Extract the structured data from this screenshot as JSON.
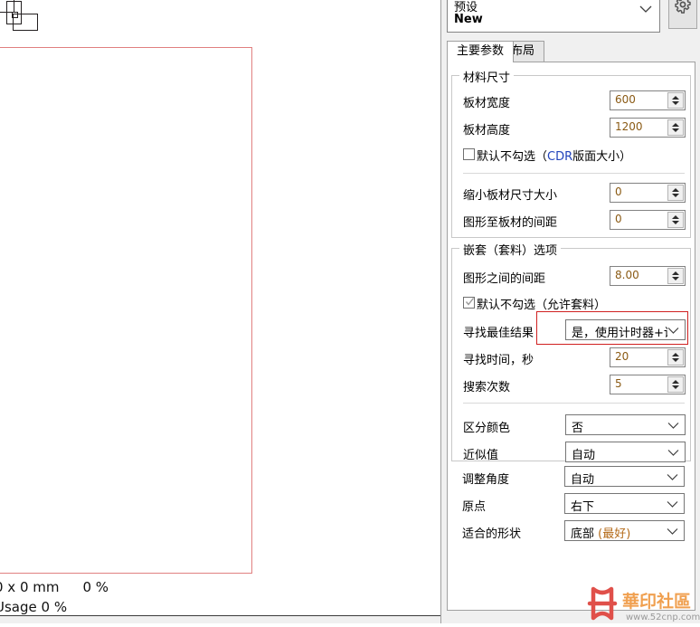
{
  "canvas": {
    "status": {
      "line1_dims": "0 x 0 mm",
      "line1_pct": "0 %",
      "line2": "Usage 0 %"
    }
  },
  "panel": {
    "preset": {
      "label": "预设",
      "value": "New",
      "chevron_icon": "chevron-down-icon"
    },
    "settings_button_icon": "gear-icon",
    "tabs": [
      {
        "label": "主要参数",
        "active": true
      },
      {
        "label": "布局",
        "active": false
      }
    ],
    "material_group": {
      "title": "材料尺寸",
      "fields": [
        {
          "label": "板材宽度",
          "value": "600"
        },
        {
          "label": "板材高度",
          "value": "1200"
        }
      ],
      "checkbox": {
        "label_a": "默认不勾选（",
        "label_b": "CDR",
        "label_c": "版面大小）",
        "checked": false
      },
      "fields2": [
        {
          "label": "缩小板材尺寸大小",
          "value": "0"
        },
        {
          "label": "图形至板材的间距",
          "value": "0"
        }
      ]
    },
    "nesting_group": {
      "title": "嵌套（套料）选项",
      "spacing": {
        "label": "图形之间的间距",
        "value": "8.00"
      },
      "checkbox": {
        "label": "默认不勾选（允许套料）",
        "checked": true
      },
      "best_result": {
        "label": "寻找最佳结果",
        "value": "是，使用计时器+计:"
      },
      "fields": [
        {
          "label": "寻找时间，秒",
          "value": "20"
        },
        {
          "label": "搜索次数",
          "value": "5"
        }
      ]
    },
    "options": [
      {
        "label": "区分颜色",
        "value": "否",
        "value_accent": ""
      },
      {
        "label": "近似值",
        "value": "自动",
        "value_accent": ""
      },
      {
        "label": "调整角度",
        "value": "自动",
        "value_accent": ""
      },
      {
        "label": "原点",
        "value": "右下",
        "value_accent": ""
      },
      {
        "label": "适合的形状",
        "value": "底部 ",
        "value_accent": "(最好)"
      }
    ]
  },
  "watermark": {
    "text": "華印社區",
    "url": "www.52cnp.com"
  },
  "colors": {
    "highlight": "#d02020",
    "sheet_outline": "#e08080",
    "spin_value": "#8a5a14",
    "accent_blue": "#2244bb",
    "accent_orange": "#b46a18",
    "panel_bg": "#f0f0f0"
  }
}
